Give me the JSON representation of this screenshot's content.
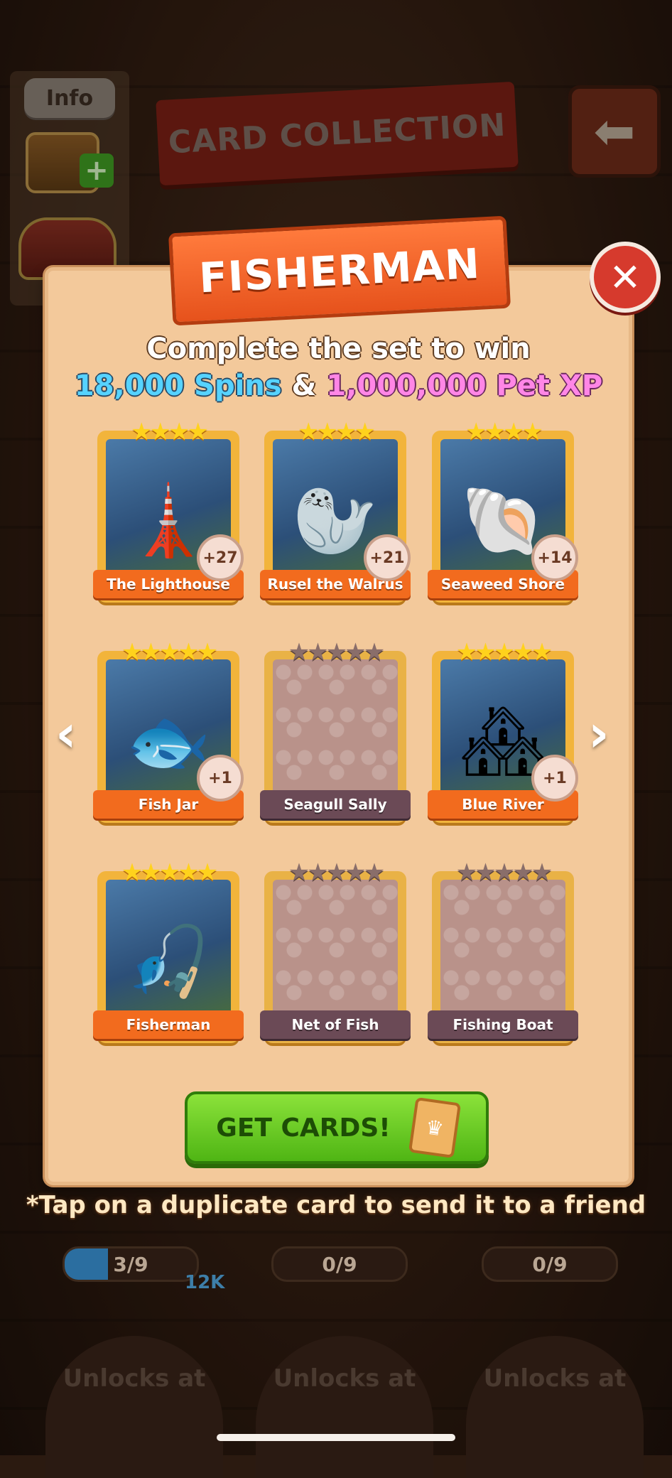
{
  "background": {
    "info_label": "Info",
    "title_banner": "CARD COLLECTION",
    "back_arrow": "back-arrow-icon",
    "tap_note": "*Tap on a duplicate card to send it to a friend",
    "progress": [
      {
        "label": "3/9",
        "fraction": 0.33
      },
      {
        "label": "0/9",
        "fraction": 0
      },
      {
        "label": "0/9",
        "fraction": 0
      }
    ],
    "badge": "12K",
    "unlock_label": "Unlocks at"
  },
  "popup": {
    "set_name": "FISHERMAN",
    "headline": "Complete the set to win",
    "reward_spins": "18,000 Spins",
    "reward_amp": "&",
    "reward_xp": "1,000,000 Pet XP",
    "get_cards_label": "GET CARDS!",
    "cards": [
      {
        "name": "The Lighthouse",
        "stars": "★★★★",
        "count": "+27",
        "owned": true,
        "icon": "🗼"
      },
      {
        "name": "Rusel the Walrus",
        "stars": "★★★★",
        "count": "+21",
        "owned": true,
        "icon": "🦭"
      },
      {
        "name": "Seaweed Shore",
        "stars": "★★★★",
        "count": "+14",
        "owned": true,
        "icon": "🐚"
      },
      {
        "name": "Fish Jar",
        "stars": "★★★★★",
        "count": "+1",
        "owned": true,
        "icon": "🐟"
      },
      {
        "name": "Seagull Sally",
        "stars": "★★★★★",
        "count": "",
        "owned": false,
        "icon": ""
      },
      {
        "name": "Blue River",
        "stars": "★★★★★",
        "count": "+1",
        "owned": true,
        "icon": "🏘"
      },
      {
        "name": "Fisherman",
        "stars": "★★★★★",
        "count": "",
        "owned": true,
        "icon": "🎣"
      },
      {
        "name": "Net of Fish",
        "stars": "★★★★★",
        "count": "",
        "owned": false,
        "icon": ""
      },
      {
        "name": "Fishing Boat",
        "stars": "★★★★★",
        "count": "",
        "owned": false,
        "icon": ""
      }
    ]
  }
}
